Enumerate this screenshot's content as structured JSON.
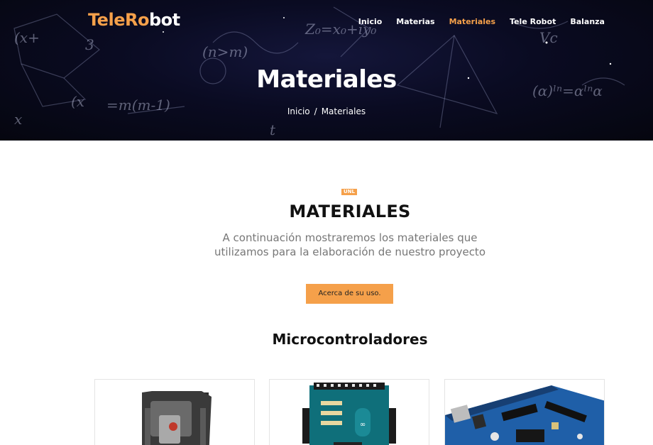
{
  "header": {
    "logo": {
      "part1": "Te",
      "part2": "le",
      "part3": "Ro",
      "part4": "bot"
    },
    "nav": [
      {
        "label": "Inicio",
        "active": false
      },
      {
        "label": "Materias",
        "active": false
      },
      {
        "label": "Materiales",
        "active": true
      },
      {
        "label": "Tele Robot",
        "active": false
      },
      {
        "label": "Balanza",
        "active": false
      }
    ]
  },
  "hero": {
    "title": "Materiales",
    "breadcrumb": {
      "home": "Inicio",
      "separator": "/",
      "current": "Materiales"
    }
  },
  "section": {
    "badge": "UNL",
    "title": "MATERIALES",
    "description": "A continuación mostraremos los materiales que utilizamos para la elaboración de nuestro proyecto",
    "button_label": "Acerca de su uso.",
    "subtitle": "Microcontroladores"
  },
  "colors": {
    "accent": "#f5a04a",
    "hero_bg": "#0a0b22"
  }
}
